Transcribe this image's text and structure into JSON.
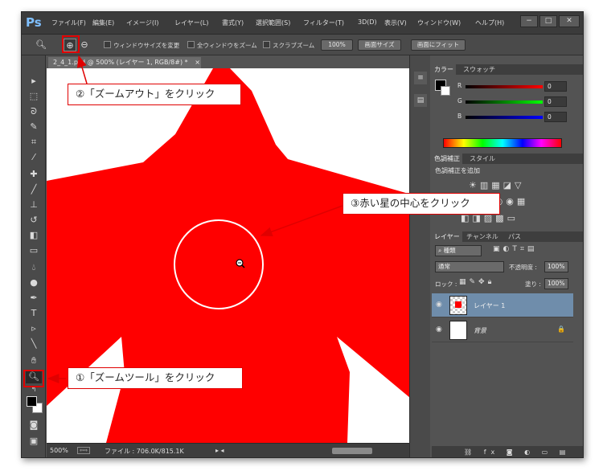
{
  "app": {
    "logo": "Ps",
    "menus": [
      "ファイル(F)",
      "編集(E)",
      "イメージ(I)",
      "レイヤー(L)",
      "書式(Y)",
      "選択範囲(S)",
      "フィルター(T)",
      "3D(D)",
      "表示(V)",
      "ウィンドウ(W)",
      "ヘルプ(H)"
    ],
    "window_buttons": [
      "−",
      "□",
      "✕"
    ]
  },
  "options_bar": {
    "check_resize": "ウィンドウサイズを変更",
    "check_all_windows": "全ウィンドウをズーム",
    "check_scrubby": "スクラブズーム",
    "btn_100": "100%",
    "btn_fit_screen": "画面サイズ",
    "btn_fill_screen": "画面にフィット",
    "icons": [
      "zoom-tool-preset-icon",
      "zoom-in-icon",
      "zoom-out-icon"
    ]
  },
  "document": {
    "tab_title": "2_4_1.psd @ 500% (レイヤー 1, RGB/8#) *",
    "tab_close": "×",
    "star_color": "#ff0000"
  },
  "status": {
    "zoom": "500%",
    "file_info": "ファイル : 706.0K/815.1K"
  },
  "color_panel": {
    "tabs": [
      "カラー",
      "スウォッチ"
    ],
    "sliders": [
      {
        "label": "R",
        "value": "0"
      },
      {
        "label": "G",
        "value": "0"
      },
      {
        "label": "B",
        "value": "0"
      }
    ]
  },
  "adjust_panel": {
    "tabs": [
      "色調補正",
      "スタイル"
    ],
    "heading": "色調補正を追加"
  },
  "layers_panel": {
    "tabs": [
      "レイヤー",
      "チャンネル",
      "パス"
    ],
    "kind_filter": "種類",
    "blend_mode": "通常",
    "opacity_label": "不透明度 :",
    "opacity_value": "100%",
    "lock_label": "ロック :",
    "fill_label": "塗り :",
    "fill_value": "100%",
    "layers": [
      {
        "name": "レイヤー 1",
        "selected": true
      },
      {
        "name": "背景",
        "selected": false
      }
    ],
    "lock_glyph": "🔒",
    "bottom_icons": "⛓ fx ◙ ◐ ▭ ▤ 🗑"
  },
  "callouts": {
    "step1": "①「ズームツール」をクリック",
    "step2": "②「ズームアウト」をクリック",
    "step3": "③赤い星の中心をクリック"
  },
  "colors": {
    "accent": "#e00000",
    "ui_dark": "#535353"
  }
}
